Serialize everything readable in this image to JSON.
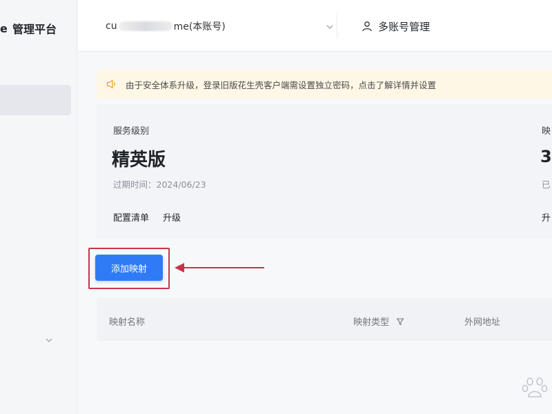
{
  "sidebar": {
    "brand_cut": "e",
    "brand_title": "管理平台",
    "active_item": ""
  },
  "header": {
    "account_prefix": "cu",
    "account_suffix": "me(本账号)",
    "multi_account_label": "多账号管理"
  },
  "notice": {
    "text": "由于安全体系升级，登录旧版花生壳客户端需设置独立密码，点击了解详情并设置"
  },
  "service": {
    "label": "服务级别",
    "level": "精英版",
    "expire_label": "过期时间：",
    "expire_date": "2024/06/23",
    "links": {
      "config_list": "配置清单",
      "upgrade": "升级"
    },
    "right_panel": {
      "label": "映",
      "value": "3",
      "sub": "已",
      "link": "升"
    }
  },
  "actions": {
    "add_mapping": "添加映射"
  },
  "table": {
    "columns": {
      "name": "映射名称",
      "type": "映射类型",
      "address": "外网地址"
    }
  },
  "colors": {
    "primary": "#2f7bf5",
    "annotation_red": "#c8334a",
    "notice_bg": "#fff7e6"
  },
  "icons": {
    "speaker": "speaker-icon",
    "user": "user-icon",
    "chevron": "chevron-down-icon",
    "filter": "filter-icon",
    "watermark": "paw-watermark-icon"
  }
}
